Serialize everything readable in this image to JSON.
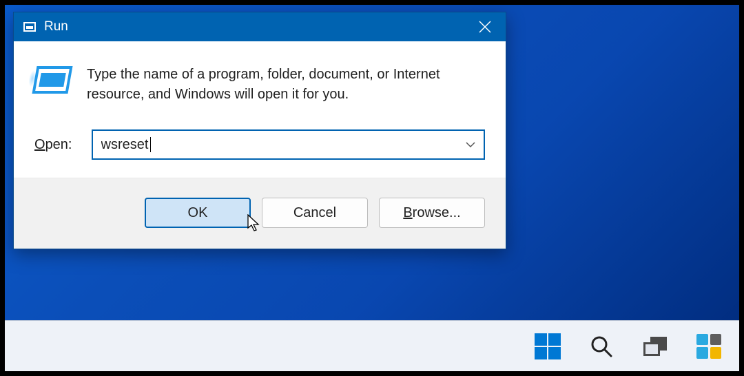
{
  "window": {
    "title": "Run",
    "description": "Type the name of a program, folder, document, or Internet resource, and Windows will open it for you.",
    "open_label": "Open:",
    "open_accesskey": "O",
    "input_value": "wsreset",
    "buttons": {
      "ok": "OK",
      "cancel": "Cancel",
      "browse": "Browse...",
      "browse_accesskey": "B"
    }
  },
  "icons": {
    "close": "close-icon",
    "run_small": "run-titlebar-icon",
    "run_large": "run-program-icon",
    "dropdown": "chevron-down-icon",
    "cursor": "mouse-cursor"
  },
  "taskbar": {
    "start": "start-icon",
    "search": "search-icon",
    "task_view": "task-view-icon",
    "widgets": "widgets-icon"
  },
  "colors": {
    "titlebar": "#0063b1",
    "desktop_gradient_a": "#0a5bcc",
    "desktop_gradient_b": "#002a7a",
    "ok_button_bg": "#cfe4f7",
    "start_blue": "#0078d4"
  }
}
